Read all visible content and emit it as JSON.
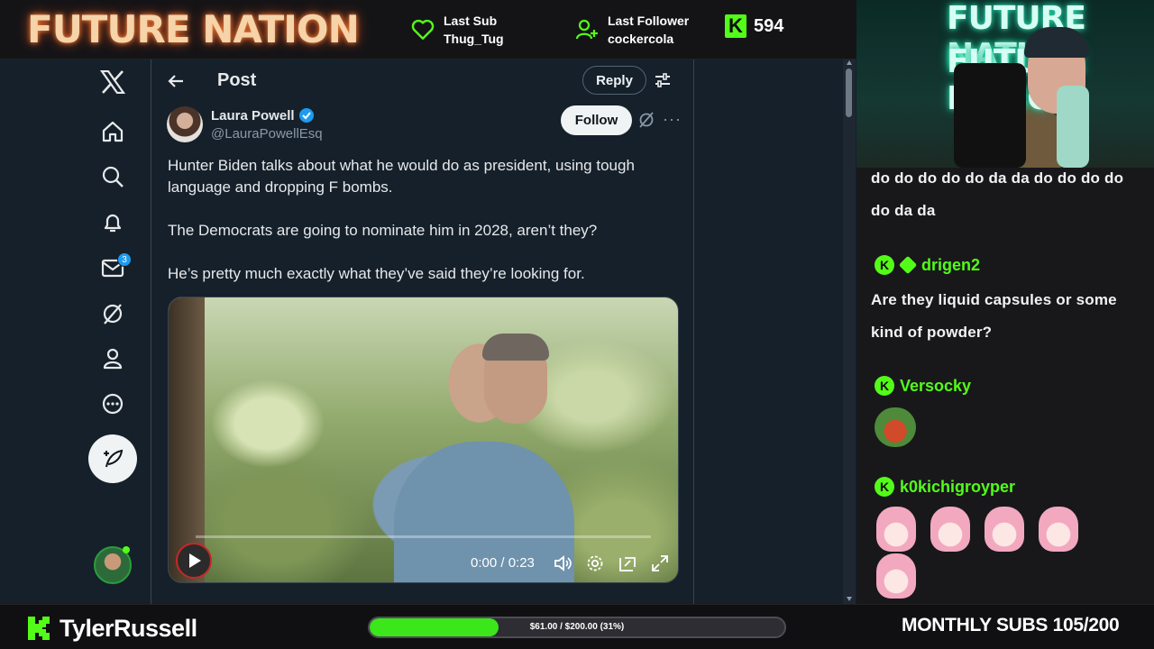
{
  "overlay": {
    "brand": "FUTURE NATION",
    "last_sub_label": "Last Sub",
    "last_sub_value": "Thug_Tug",
    "last_follower_label": "Last Follower",
    "last_follower_value": "cockercola",
    "kick_viewers": "594",
    "kick_icon": "K",
    "colors": {
      "kick_green": "#53fc18",
      "twitter_bg": "#15202b"
    }
  },
  "nav": {
    "icons": [
      "x-logo-icon",
      "home-icon",
      "search-icon",
      "notifications-icon",
      "messages-icon",
      "grok-icon",
      "profile-icon",
      "more-icon"
    ],
    "messages_badge": "3"
  },
  "post": {
    "header_title": "Post",
    "reply_label": "Reply",
    "author_name": "Laura Powell",
    "author_handle": "@LauraPowellEsq",
    "follow_label": "Follow",
    "more_label": "···",
    "paragraphs": [
      "Hunter Biden talks about what he would do as president, using tough language and dropping F bombs.",
      "The Democrats are going to nominate him in 2028, aren’t they?",
      "He’s pretty much exactly what they’ve said they’re looking for."
    ],
    "video": {
      "time": "0:00 / 0:23",
      "progress": 0
    }
  },
  "webcam": {
    "neon_text": "FUTURE NATION"
  },
  "chat": {
    "continued_text": "do do do do do da da do do do do do da da",
    "messages": [
      {
        "user": "drigen2",
        "text": "Are they liquid capsules or some kind of powder?"
      },
      {
        "user": "Versocky",
        "text": ""
      },
      {
        "user": "k0kichigroyper",
        "text": ""
      }
    ]
  },
  "bottom": {
    "streamer_name": "TylerRussell",
    "goal_text": "$61.00 / $200.00 (31%)",
    "goal_fraction": 0.31,
    "monthly_subs": "MONTHLY SUBS 105/200"
  }
}
